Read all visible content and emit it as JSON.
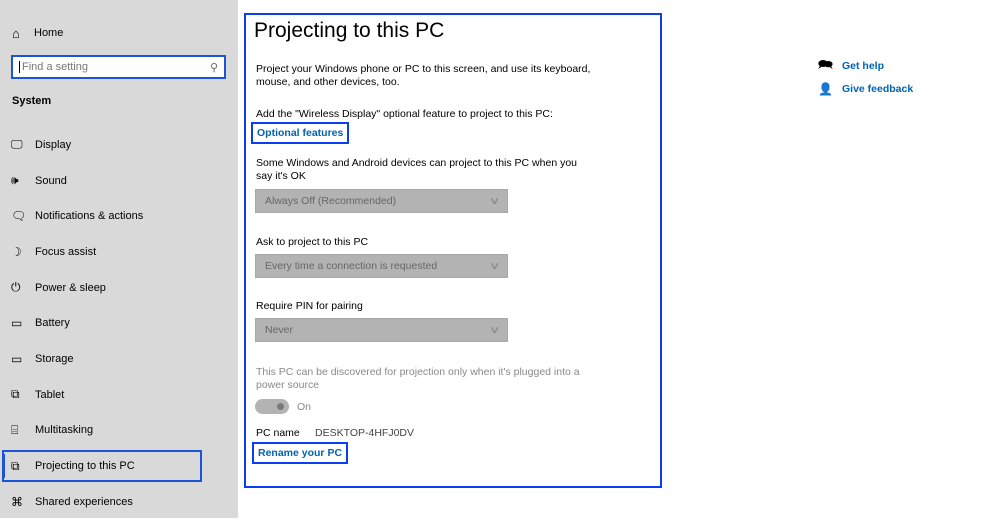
{
  "sidebar": {
    "home_label": "Home",
    "search_placeholder": "Find a setting",
    "section_title": "System",
    "items": [
      {
        "label": "Display",
        "icon": "display-icon",
        "glyph": "🖵"
      },
      {
        "label": "Sound",
        "icon": "sound-icon",
        "glyph": "🔊"
      },
      {
        "label": "Notifications & actions",
        "icon": "notifications-icon",
        "glyph": "🗨"
      },
      {
        "label": "Focus assist",
        "icon": "focus-assist-moon-icon",
        "glyph": "☽"
      },
      {
        "label": "Power & sleep",
        "icon": "power-icon",
        "glyph": "⏻"
      },
      {
        "label": "Battery",
        "icon": "battery-icon",
        "glyph": "▭"
      },
      {
        "label": "Storage",
        "icon": "storage-icon",
        "glyph": "▭"
      },
      {
        "label": "Tablet",
        "icon": "tablet-icon",
        "glyph": "⧉"
      },
      {
        "label": "Multitasking",
        "icon": "multitasking-icon",
        "glyph": "⌸"
      },
      {
        "label": "Projecting to this PC",
        "icon": "projecting-icon",
        "glyph": "⧉",
        "selected": true
      },
      {
        "label": "Shared experiences",
        "icon": "shared-experiences-icon",
        "glyph": "⌘"
      }
    ]
  },
  "main": {
    "title": "Projecting to this PC",
    "intro": "Project your Windows phone or PC to this screen, and use its keyboard, mouse, and other devices, too.",
    "wireless_text": "Add the \"Wireless Display\" optional feature to project to this PC:",
    "optional_features_link": "Optional features",
    "devices_text": "Some Windows and Android devices can project to this PC when you say it's OK",
    "devices_dropdown": "Always Off (Recommended)",
    "ask_label": "Ask to project to this PC",
    "ask_dropdown": "Every time a connection is requested",
    "pin_label": "Require PIN for pairing",
    "pin_dropdown": "Never",
    "power_text": "This PC can be discovered for projection only when it's plugged into a power source",
    "toggle_state": "On",
    "pc_name_label": "PC name",
    "pc_name_value": "DESKTOP-4HFJ0DV",
    "rename_link": "Rename your PC"
  },
  "help": {
    "get_help": "Get help",
    "give_feedback": "Give feedback"
  },
  "colors": {
    "accent_link": "#0063b1",
    "highlight_box": "#0b3ef0",
    "sidebar_bg": "#d9d9d9"
  }
}
